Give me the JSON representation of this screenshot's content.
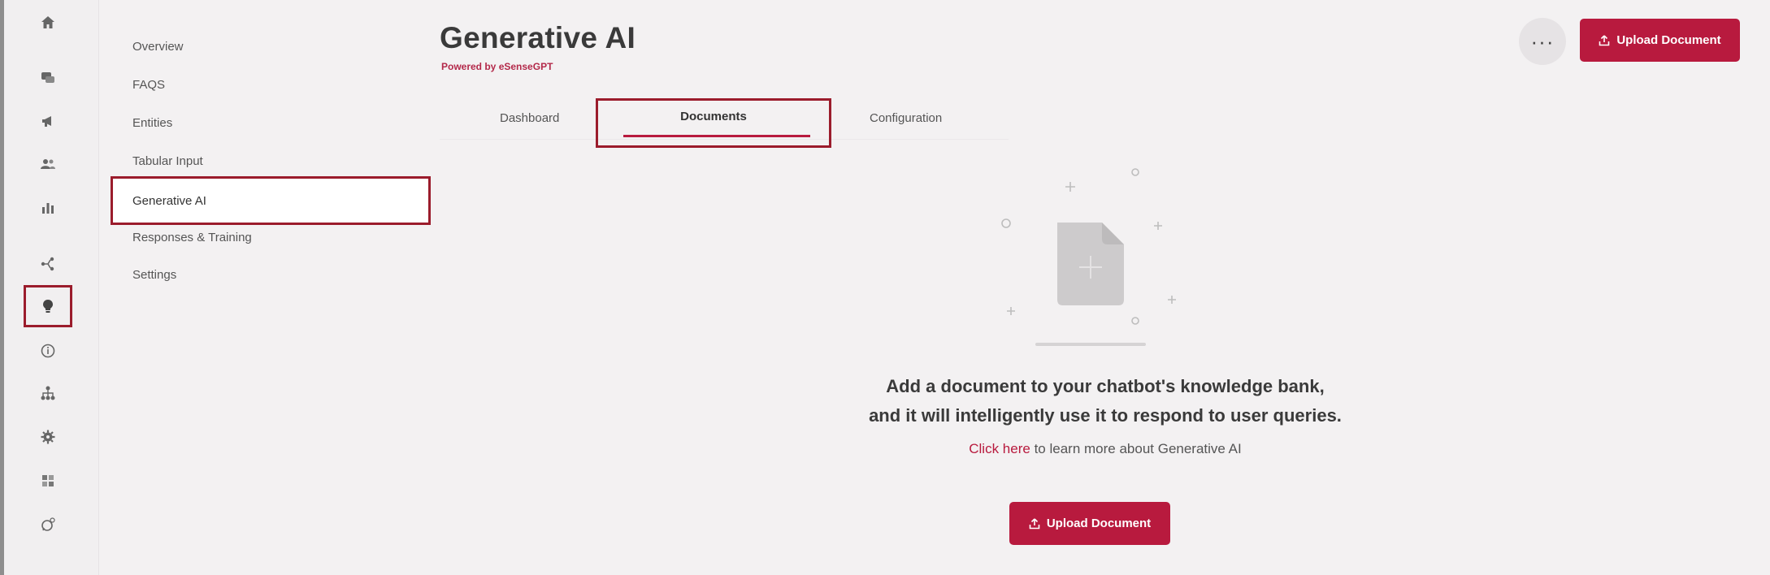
{
  "rail": {
    "icons": [
      "home-icon",
      "chat-icon",
      "megaphone-icon",
      "users-icon",
      "bar-chart-icon",
      "flow-icon",
      "bulb-icon",
      "info-icon",
      "hierarchy-icon",
      "settings-icon",
      "grid-icon",
      "whatsapp-icon"
    ],
    "active": "bulb-icon"
  },
  "subnav": {
    "items": [
      "Overview",
      "FAQS",
      "Entities",
      "Tabular Input",
      "Generative AI",
      "Responses & Training",
      "Settings"
    ],
    "active_label": "Generative AI"
  },
  "header": {
    "title": "Generative AI",
    "powered_prefix": "Powered by",
    "powered_brand": "eSenseGPT",
    "more_label": "···",
    "upload_label": "Upload Document"
  },
  "tabs": {
    "items": [
      "Dashboard",
      "Documents",
      "Configuration"
    ],
    "active": "Documents"
  },
  "empty_state": {
    "title_line1": "Add a document to your chatbot's knowledge bank,",
    "title_line2": "and it will intelligently use it to respond to user queries.",
    "link_text": "Click here",
    "learn_suffix": "to learn more about Generative AI",
    "upload_label": "Upload Document"
  },
  "colors": {
    "accent": "#b81a3e",
    "highlight_border": "#9b1c2c",
    "background": "#f3f1f2"
  }
}
